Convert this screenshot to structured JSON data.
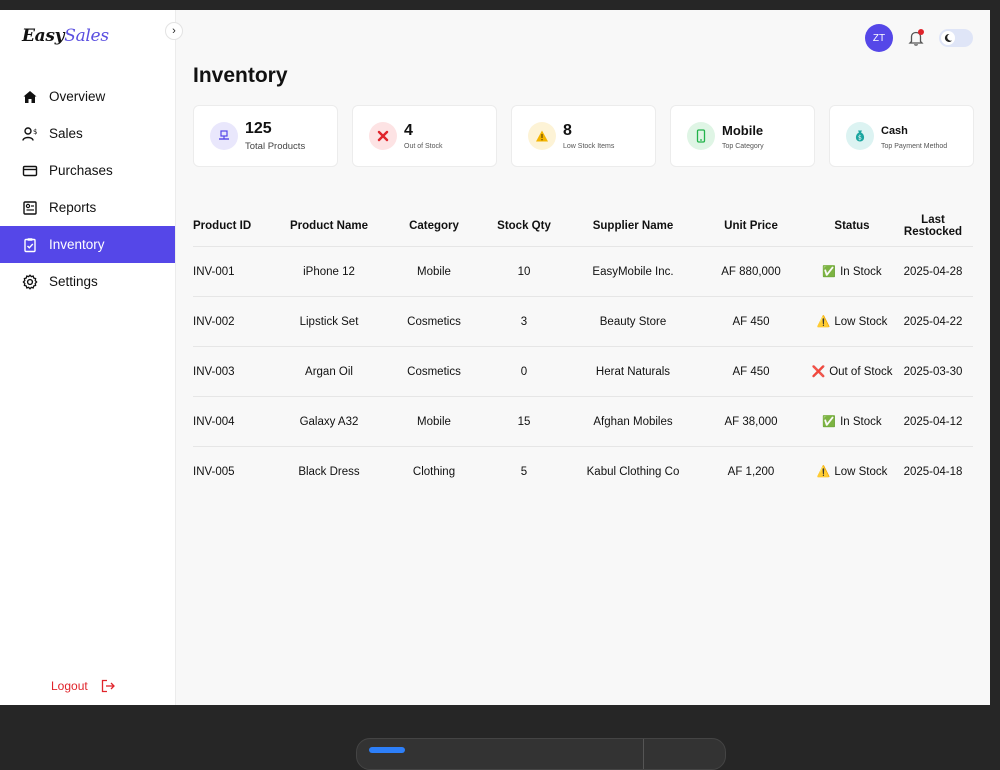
{
  "brand": {
    "easy": "Easy",
    "sales": "Sales"
  },
  "sidebar": {
    "items": [
      {
        "label": "Overview",
        "icon": "home-icon"
      },
      {
        "label": "Sales",
        "icon": "user-dollar-icon"
      },
      {
        "label": "Purchases",
        "icon": "credit-card-icon"
      },
      {
        "label": "Reports",
        "icon": "report-icon"
      },
      {
        "label": "Inventory",
        "icon": "clipboard-check-icon"
      },
      {
        "label": "Settings",
        "icon": "gear-icon"
      }
    ],
    "active": "Inventory",
    "logout": "Logout"
  },
  "topbar": {
    "avatar_initials": "ZT"
  },
  "page": {
    "title": "Inventory"
  },
  "cards": [
    {
      "value": "125",
      "label": "Total Products",
      "icon": "box-icon",
      "color": "#5547e8"
    },
    {
      "value": "4",
      "label": "Out of Stock",
      "icon": "x-icon",
      "color": "#e0242b"
    },
    {
      "value": "8",
      "label": "Low Stock Items",
      "icon": "warning-icon",
      "color": "#f4b400"
    },
    {
      "value": "Mobile",
      "label": "Top Category",
      "icon": "phone-icon",
      "color": "#22b34a"
    },
    {
      "value": "Cash",
      "label": "Top Payment Method",
      "icon": "money-bag-icon",
      "color": "#1ba6a0"
    }
  ],
  "table": {
    "headers": [
      "Product ID",
      "Product Name",
      "Category",
      "Stock Qty",
      "Supplier Name",
      "Unit Price",
      "Status",
      "Last Restocked"
    ],
    "rows": [
      {
        "id": "INV-001",
        "name": "iPhone 12",
        "category": "Mobile",
        "qty": "10",
        "supplier": "EasyMobile Inc.",
        "price": "AF 880,000",
        "status": "In Stock",
        "status_icon": "✅",
        "date": "2025-04-28"
      },
      {
        "id": "INV-002",
        "name": "Lipstick Set",
        "category": "Cosmetics",
        "qty": "3",
        "supplier": "Beauty Store",
        "price": "AF 450",
        "status": "Low Stock",
        "status_icon": "⚠️",
        "date": "2025-04-22"
      },
      {
        "id": "INV-003",
        "name": "Argan Oil",
        "category": "Cosmetics",
        "qty": "0",
        "supplier": "Herat Naturals",
        "price": "AF 450",
        "status": "Out of Stock",
        "status_icon": "❌",
        "date": "2025-03-30"
      },
      {
        "id": "INV-004",
        "name": "Galaxy A32",
        "category": "Mobile",
        "qty": "15",
        "supplier": "Afghan Mobiles",
        "price": "AF 38,000",
        "status": "In Stock",
        "status_icon": "✅",
        "date": "2025-04-12"
      },
      {
        "id": "INV-005",
        "name": "Black Dress",
        "category": "Clothing",
        "qty": "5",
        "supplier": "Kabul Clothing Co",
        "price": "AF 1,200",
        "status": "Low Stock",
        "status_icon": "⚠️",
        "date": "2025-04-18"
      }
    ]
  },
  "colors": {
    "accent": "#5547e8",
    "danger": "#e0242b",
    "warning": "#f4b400",
    "success": "#22b34a"
  }
}
